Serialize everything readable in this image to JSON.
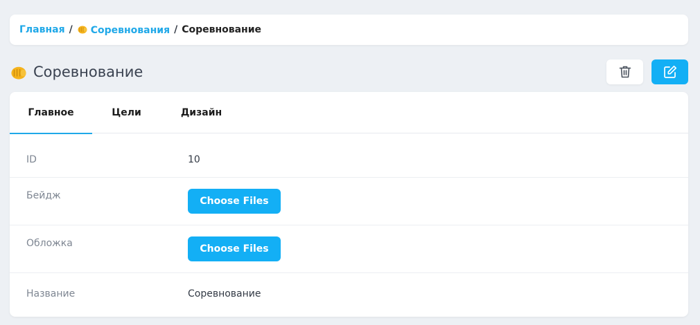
{
  "breadcrumb": {
    "home": "Главная",
    "separator": "/",
    "parent": "Соревнования",
    "current": "Соревнование"
  },
  "header": {
    "title": "Соревнование",
    "delete_icon": "trash-icon",
    "edit_icon": "edit-icon"
  },
  "tabs": [
    {
      "label": "Главное",
      "active": true
    },
    {
      "label": "Цели",
      "active": false
    },
    {
      "label": "Дизайн",
      "active": false
    }
  ],
  "fields": {
    "id": {
      "label": "ID",
      "value": "10"
    },
    "badge": {
      "label": "Бейдж",
      "button": "Choose Files"
    },
    "cover": {
      "label": "Обложка",
      "button": "Choose Files"
    },
    "name": {
      "label": "Название",
      "value": "Соревнование"
    }
  },
  "colors": {
    "accent": "#13aff5",
    "link": "#1fa8e8",
    "background": "#edf0f4",
    "emoji": "#f5b31c"
  }
}
